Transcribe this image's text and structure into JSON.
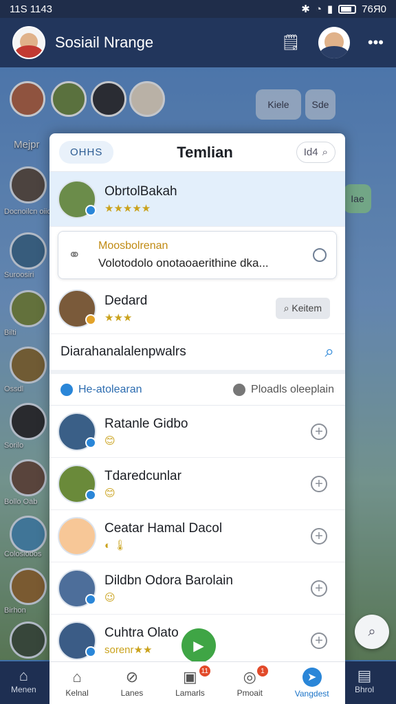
{
  "status": {
    "time": "11S 1143",
    "right": "76Я0"
  },
  "header": {
    "title": "Sosiail Nrange"
  },
  "background": {
    "left_label_top": "Mejpr",
    "left_names": [
      "Docnoilcn oiioe",
      "Suroosiri",
      "Bilti",
      "Ossdl",
      "Sorilo",
      "Bollo Oab",
      "Colosiobos",
      "Birhon"
    ],
    "pills": [
      "Kiele",
      "Sde",
      "Iae"
    ]
  },
  "modal": {
    "tag": "OHHS",
    "title": "Temlian",
    "search": "Id4",
    "selected": {
      "name": "ObrtolBakah",
      "stars": "★★★★★"
    },
    "card": {
      "title": "Moosbolrenan",
      "desc": "Volotodolo onotaoaerithine dka..."
    },
    "third": {
      "name": "Dedard",
      "stars": "★★★",
      "button": "Keitem"
    },
    "search_row": "Diarahanalalenpwalrs",
    "filter_left": "He-atolearan",
    "filter_right": "Ploadls oleeplain",
    "list": [
      {
        "name": "Ratanle Gidbo",
        "sub": "😊"
      },
      {
        "name": "Tdaredcunlar",
        "sub": "😊"
      },
      {
        "name": "Ceatar Hamal Dacol",
        "sub": "◐ 🌡"
      },
      {
        "name": "Dildbn Odora Barolain",
        "sub": "😉"
      },
      {
        "name": "Cuhtra Olato",
        "sub": "sorenr★★"
      }
    ]
  },
  "nav": [
    {
      "label": "Kelnal",
      "icon": "⌂"
    },
    {
      "label": "Lanes",
      "icon": "⊘"
    },
    {
      "label": "Lamarls",
      "icon": "▣",
      "badge": "11"
    },
    {
      "label": "Pmoait",
      "icon": "◎",
      "badge": "1"
    },
    {
      "label": "Vangdest",
      "icon": "➤"
    }
  ],
  "nav_outer": {
    "left": "Menen",
    "right": "Bhrol"
  },
  "icons": {
    "search": "search-icon",
    "more": "more-icon",
    "notes": "notes-icon",
    "play": "play-icon",
    "link": "link-icon"
  }
}
